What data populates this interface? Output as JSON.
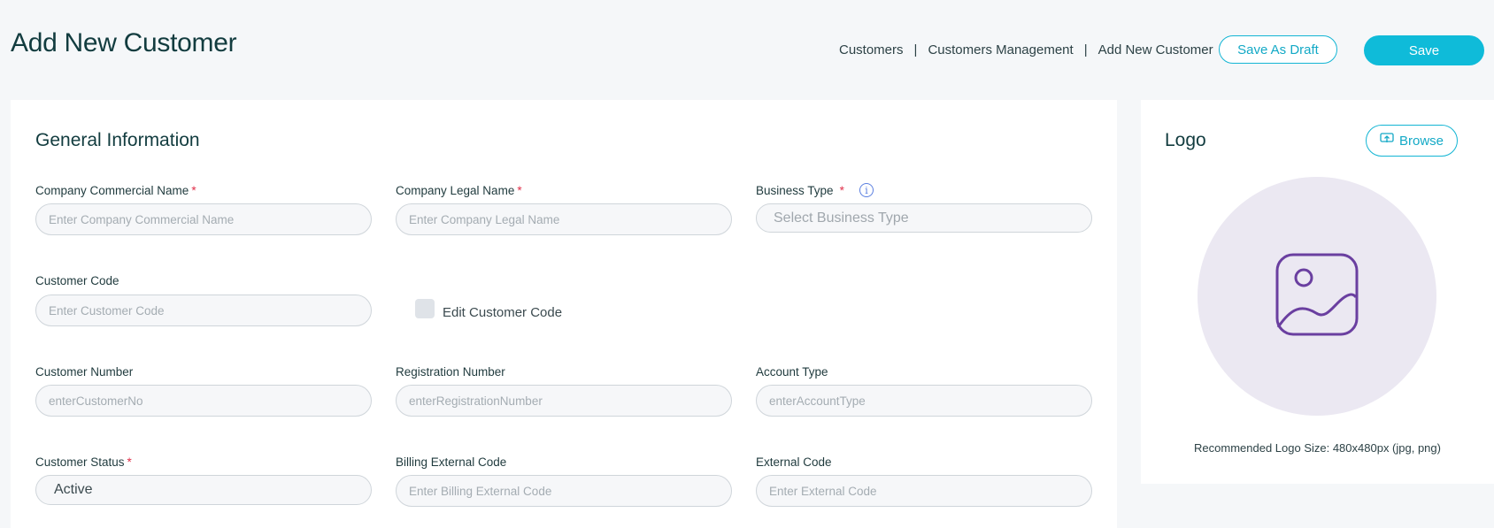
{
  "header": {
    "title": "Add New Customer",
    "breadcrumb": [
      "Customers",
      "Customers Management",
      "Add New Customer"
    ],
    "breadcrumb_separator": "|",
    "save_draft_label": "Save As Draft",
    "save_label": "Save"
  },
  "general": {
    "title": "General Information",
    "fields": {
      "commercial_name": {
        "label": "Company Commercial Name",
        "required": "*",
        "placeholder": "Enter Company Commercial Name"
      },
      "legal_name": {
        "label": "Company Legal Name",
        "required": "*",
        "placeholder": "Enter Company Legal Name"
      },
      "business_type": {
        "label": "Business Type",
        "required": "*",
        "placeholder": "Select Business Type",
        "info_icon": "info-icon"
      },
      "customer_code": {
        "label": "Customer Code",
        "placeholder": "Enter Customer Code"
      },
      "edit_customer_code": {
        "label": "Edit Customer Code",
        "checked": false
      },
      "customer_number": {
        "label": "Customer Number",
        "placeholder": "enterCustomerNo"
      },
      "registration_number": {
        "label": "Registration Number",
        "placeholder": "enterRegistrationNumber"
      },
      "account_type": {
        "label": "Account Type",
        "placeholder": "enterAccountType"
      },
      "customer_status": {
        "label": "Customer Status",
        "required": "*",
        "value": "Active"
      },
      "billing_external_code": {
        "label": "Billing External Code",
        "placeholder": "Enter Billing External Code"
      },
      "external_code": {
        "label": "External Code",
        "placeholder": "Enter External Code"
      }
    }
  },
  "logo": {
    "title": "Logo",
    "browse_label": "Browse",
    "browse_icon": "upload-icon",
    "placeholder_icon": "image-icon",
    "hint": "Recommended Logo Size: 480x480px (jpg, png)"
  },
  "colors": {
    "accent": "#0fbbd9",
    "required": "#e0304a",
    "title": "#123c3f",
    "image_icon": "#6a3fa0"
  }
}
